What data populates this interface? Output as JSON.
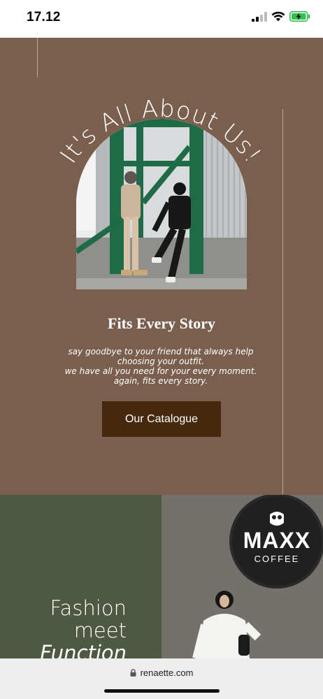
{
  "status_bar": {
    "time": "17.12",
    "icons": [
      "cellular-signal-icon",
      "wifi-icon",
      "battery-charging-icon"
    ]
  },
  "hero": {
    "arc_title": "It's All About Us!",
    "heading": "Fits Every Story",
    "description": [
      "say goodbye to your friend that always help",
      "choosing your outfit.",
      "we have all you need for your every moment.",
      "again, fits every story."
    ],
    "button_label": "Our Catalogue",
    "colors": {
      "background": "#7a5f4e",
      "button": "#46280f"
    }
  },
  "fashion": {
    "lines": [
      "Fashion",
      "meet",
      "Function"
    ],
    "sign": {
      "brand": "MAXX",
      "sub": "COFFEE"
    },
    "colors": {
      "left_panel": "#4f5840"
    }
  },
  "browser": {
    "url": "renaette.com"
  }
}
